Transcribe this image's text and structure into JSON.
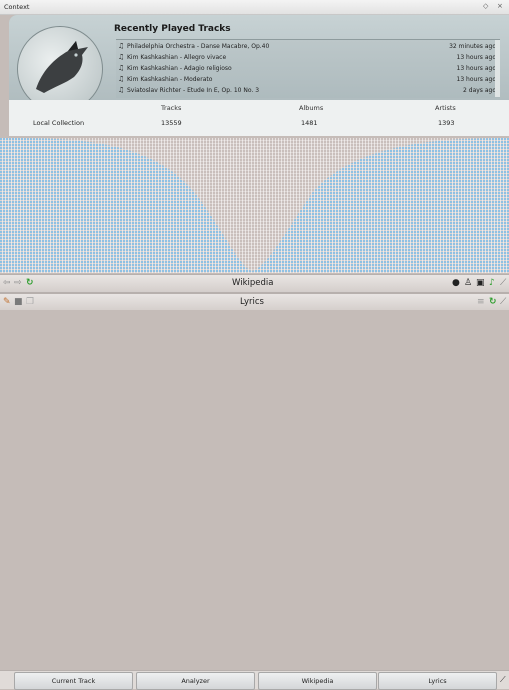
{
  "window": {
    "title": "Context",
    "float_icon": "◇",
    "close_icon": "×"
  },
  "recent": {
    "title": "Recently Played Tracks",
    "tracks": [
      {
        "name": "Philadelphia Orchestra - Danse Macabre, Op.40",
        "when": "32 minutes ago"
      },
      {
        "name": "Kim Kashkashian - Allegro vivace",
        "when": "13 hours ago"
      },
      {
        "name": "Kim Kashkashian - Adagio religioso",
        "when": "13 hours ago"
      },
      {
        "name": "Kim Kashkashian - Moderato",
        "when": "13 hours ago"
      },
      {
        "name": "Sviatoslav Richter - Etude In E, Op. 10 No. 3",
        "when": "2 days ago"
      }
    ]
  },
  "collection": {
    "label": "Local Collection",
    "headers": {
      "tracks": "Tracks",
      "albums": "Albums",
      "artists": "Artists"
    },
    "values": {
      "tracks": "13559",
      "albums": "1481",
      "artists": "1393"
    }
  },
  "wikipedia": {
    "title": "Wikipedia",
    "icons": [
      "back-icon",
      "forward-icon",
      "reload-icon",
      "artist-icon",
      "album-icon",
      "track-icon",
      "music-icon",
      "settings-icon"
    ]
  },
  "lyrics": {
    "title": "Lyrics",
    "icons": [
      "edit-icon",
      "save-icon",
      "copy-icon",
      "scroll-icon",
      "reload-icon",
      "settings-icon"
    ]
  },
  "tabs": [
    "Current Track",
    "Analyzer",
    "Wikipedia",
    "Lyrics"
  ],
  "colors": {
    "accent": "#2e9e2e",
    "analyzer_bars": "#9ccbe8"
  }
}
